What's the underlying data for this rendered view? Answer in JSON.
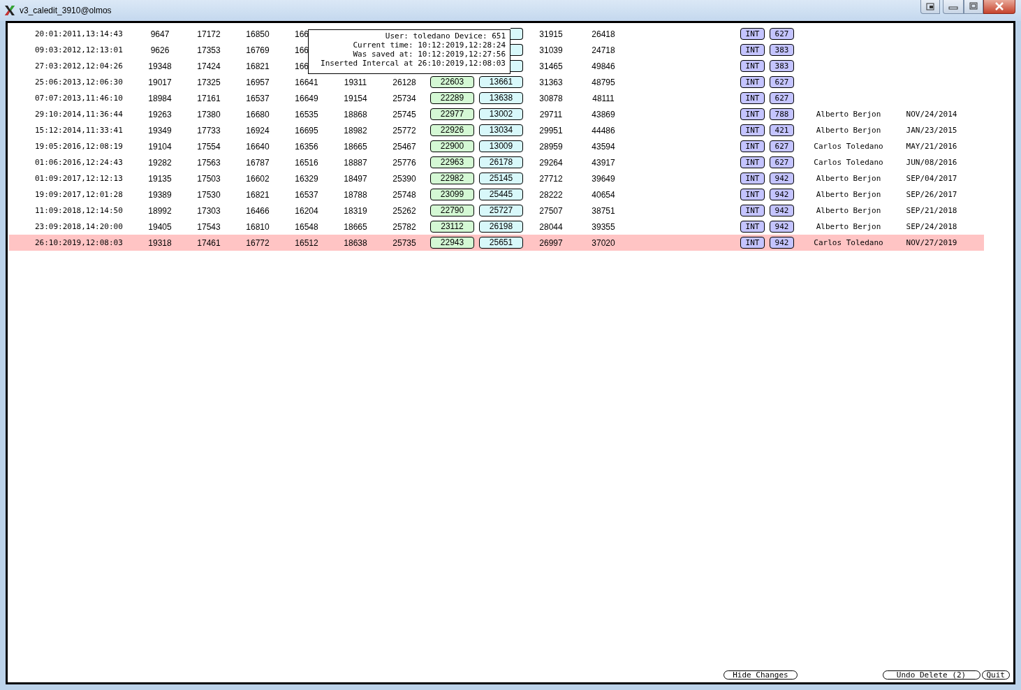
{
  "window": {
    "title": "v3_caledit_3910@olmos"
  },
  "rows": [
    {
      "selected": false,
      "cells": [
        "20:01:2011,13:14:43",
        "9647",
        "17172",
        "16850",
        "166",
        null,
        null,
        null,
        null,
        "31915",
        "26418"
      ],
      "type": "INT",
      "device": "627"
    },
    {
      "selected": false,
      "cells": [
        "09:03:2012,12:13:01",
        "9626",
        "17353",
        "16769",
        "166",
        null,
        null,
        null,
        null,
        "31039",
        "24718"
      ],
      "type": "INT",
      "device": "383"
    },
    {
      "selected": false,
      "cells": [
        "27:03:2012,12:04:26",
        "19348",
        "17424",
        "16821",
        "166",
        null,
        null,
        null,
        null,
        "31465",
        "49846"
      ],
      "type": "INT",
      "device": "383"
    },
    {
      "selected": false,
      "cells": [
        "25:06:2013,12:06:30",
        "19017",
        "17325",
        "16957",
        "16641",
        "19311",
        "26128",
        "22603",
        "13661",
        "31363",
        "48795"
      ],
      "type": "INT",
      "device": "627"
    },
    {
      "selected": false,
      "cells": [
        "07:07:2013,11:46:10",
        "18984",
        "17161",
        "16537",
        "16649",
        "19154",
        "25734",
        "22289",
        "13638",
        "30878",
        "48111"
      ],
      "type": "INT",
      "device": "627"
    },
    {
      "selected": false,
      "cells": [
        "29:10:2014,11:36:44",
        "19263",
        "17380",
        "16680",
        "16535",
        "18868",
        "25745",
        "22977",
        "13002",
        "29711",
        "43869"
      ],
      "type": "INT",
      "device": "788",
      "user": "Alberto Berjon",
      "date": "NOV/24/2014"
    },
    {
      "selected": false,
      "cells": [
        "15:12:2014,11:33:41",
        "19349",
        "17733",
        "16924",
        "16695",
        "18982",
        "25772",
        "22926",
        "13034",
        "29951",
        "44486"
      ],
      "type": "INT",
      "device": "421",
      "user": "Alberto Berjon",
      "date": "JAN/23/2015"
    },
    {
      "selected": false,
      "cells": [
        "19:05:2016,12:08:19",
        "19104",
        "17554",
        "16640",
        "16356",
        "18665",
        "25467",
        "22900",
        "13009",
        "28959",
        "43594"
      ],
      "type": "INT",
      "device": "627",
      "user": "Carlos Toledano",
      "date": "MAY/21/2016"
    },
    {
      "selected": false,
      "cells": [
        "01:06:2016,12:24:43",
        "19282",
        "17563",
        "16787",
        "16516",
        "18887",
        "25776",
        "22963",
        "26178",
        "29264",
        "43917"
      ],
      "type": "INT",
      "device": "627",
      "user": "Carlos Toledano",
      "date": "JUN/08/2016"
    },
    {
      "selected": false,
      "cells": [
        "01:09:2017,12:12:13",
        "19135",
        "17503",
        "16602",
        "16329",
        "18497",
        "25390",
        "22982",
        "25145",
        "27712",
        "39649"
      ],
      "type": "INT",
      "device": "942",
      "user": "Alberto Berjon",
      "date": "SEP/04/2017"
    },
    {
      "selected": false,
      "cells": [
        "19:09:2017,12:01:28",
        "19389",
        "17530",
        "16821",
        "16537",
        "18788",
        "25748",
        "23099",
        "25445",
        "28222",
        "40654"
      ],
      "type": "INT",
      "device": "942",
      "user": "Alberto Berjon",
      "date": "SEP/26/2017"
    },
    {
      "selected": false,
      "cells": [
        "11:09:2018,12:14:50",
        "18992",
        "17303",
        "16466",
        "16204",
        "18319",
        "25262",
        "22790",
        "25727",
        "27507",
        "38751"
      ],
      "type": "INT",
      "device": "942",
      "user": "Alberto Berjon",
      "date": "SEP/21/2018"
    },
    {
      "selected": false,
      "cells": [
        "23:09:2018,14:20:00",
        "19405",
        "17543",
        "16810",
        "16548",
        "18665",
        "25782",
        "23112",
        "26198",
        "28044",
        "39355"
      ],
      "type": "INT",
      "device": "942",
      "user": "Alberto Berjon",
      "date": "SEP/24/2018"
    },
    {
      "selected": true,
      "cells": [
        "26:10:2019,12:08:03",
        "19318",
        "17461",
        "16772",
        "16512",
        "18638",
        "25735",
        "22943",
        "25651",
        "26997",
        "37020"
      ],
      "type": "INT",
      "device": "942",
      "user": "Carlos Toledano",
      "date": "NOV/27/2019"
    }
  ],
  "tooltip": [
    "User: toledano Device: 651",
    "Current time: 10:12:2019,12:28:24",
    "Was saved at: 10:12:2019,12:27:56",
    "Inserted Intercal at 26:10:2019,12:08:03"
  ],
  "buttons": [
    {
      "label": "Hide Changes",
      "kind": "left"
    },
    {
      "label": "Undo Delete (2)",
      "kind": "right"
    },
    {
      "label": "Quit",
      "kind": "right"
    }
  ]
}
